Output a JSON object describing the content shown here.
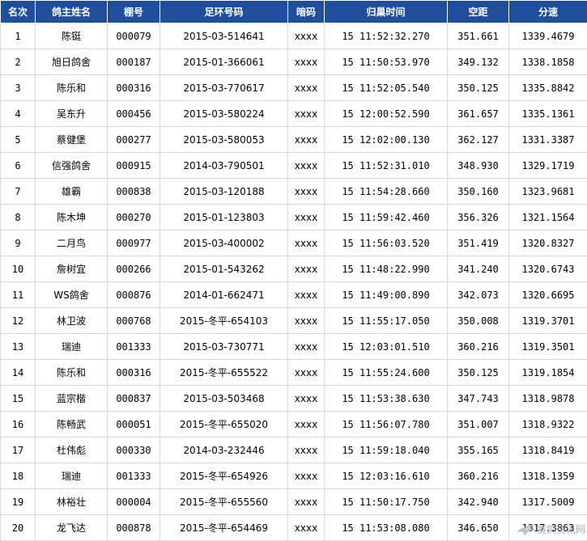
{
  "headers": [
    "名次",
    "鸽主姓名",
    "棚号",
    "足环号码",
    "暗码",
    "归巢时间",
    "空距",
    "分速"
  ],
  "rows": [
    [
      "1",
      "陈铤",
      "000079",
      "2015-03-514641",
      "xxxx",
      "15 11:52:32.270",
      "351.661",
      "1339.4679"
    ],
    [
      "2",
      "旭日鸽舍",
      "000187",
      "2015-01-366061",
      "xxxx",
      "15 11:50:53.970",
      "349.132",
      "1338.1858"
    ],
    [
      "3",
      "陈乐和",
      "000316",
      "2015-03-770617",
      "xxxx",
      "15 11:52:05.540",
      "350.125",
      "1335.8842"
    ],
    [
      "4",
      "吴东升",
      "000456",
      "2015-03-580224",
      "xxxx",
      "15 12:00:52.590",
      "361.657",
      "1335.1361"
    ],
    [
      "5",
      "蔡健堡",
      "000277",
      "2015-03-580053",
      "xxxx",
      "15 12:02:00.130",
      "362.127",
      "1331.3387"
    ],
    [
      "6",
      "信强鸽舍",
      "000915",
      "2014-03-790501",
      "xxxx",
      "15 11:52:31.010",
      "348.930",
      "1329.1719"
    ],
    [
      "7",
      "雄霸",
      "000838",
      "2015-03-120188",
      "xxxx",
      "15 11:54:28.660",
      "350.160",
      "1323.9681"
    ],
    [
      "8",
      "陈木坤",
      "000270",
      "2015-01-123803",
      "xxxx",
      "15 11:59:42.460",
      "356.326",
      "1321.1564"
    ],
    [
      "9",
      "二月鸟",
      "000977",
      "2015-03-400002",
      "xxxx",
      "15 11:56:03.520",
      "351.419",
      "1320.8327"
    ],
    [
      "10",
      "詹树宜",
      "000266",
      "2015-01-543262",
      "xxxx",
      "15 11:48:22.990",
      "341.240",
      "1320.6743"
    ],
    [
      "11",
      "WS鸽舍",
      "000876",
      "2014-01-662471",
      "xxxx",
      "15 11:49:00.890",
      "342.073",
      "1320.6695"
    ],
    [
      "12",
      "林卫波",
      "000768",
      "2015-冬平-654103",
      "xxxx",
      "15 11:55:17.050",
      "350.008",
      "1319.3701"
    ],
    [
      "13",
      "瑞迪",
      "001333",
      "2015-03-730771",
      "xxxx",
      "15 12:03:01.510",
      "360.216",
      "1319.3501"
    ],
    [
      "14",
      "陈乐和",
      "000316",
      "2015-冬平-655522",
      "xxxx",
      "15 11:55:24.600",
      "350.125",
      "1319.1854"
    ],
    [
      "15",
      "蓝宗楷",
      "000837",
      "2015-03-503468",
      "xxxx",
      "15 11:53:38.630",
      "347.743",
      "1318.9878"
    ],
    [
      "16",
      "陈畅武",
      "000051",
      "2015-冬平-655020",
      "xxxx",
      "15 11:56:07.780",
      "351.007",
      "1318.9322"
    ],
    [
      "17",
      "杜伟彪",
      "000330",
      "2014-03-232446",
      "xxxx",
      "15 11:59:18.040",
      "355.165",
      "1318.8419"
    ],
    [
      "18",
      "瑞迪",
      "001333",
      "2015-冬平-654926",
      "xxxx",
      "15 12:03:16.610",
      "360.216",
      "1318.1359"
    ],
    [
      "19",
      "林裕壮",
      "000004",
      "2015-冬平-655560",
      "xxxx",
      "15 11:50:17.750",
      "342.940",
      "1317.5009"
    ],
    [
      "20",
      "龙飞达",
      "000878",
      "2015-冬平-654469",
      "xxxx",
      "15 11:53:08.080",
      "346.650",
      "1317.3863"
    ]
  ],
  "watermark": {
    "icon": "pigeon-logo-icon",
    "text": "赛鸽资讯网"
  },
  "colors": {
    "header_bg": "#1f4f9c",
    "header_text": "#ffffff",
    "grid": "#d3dbe6"
  }
}
